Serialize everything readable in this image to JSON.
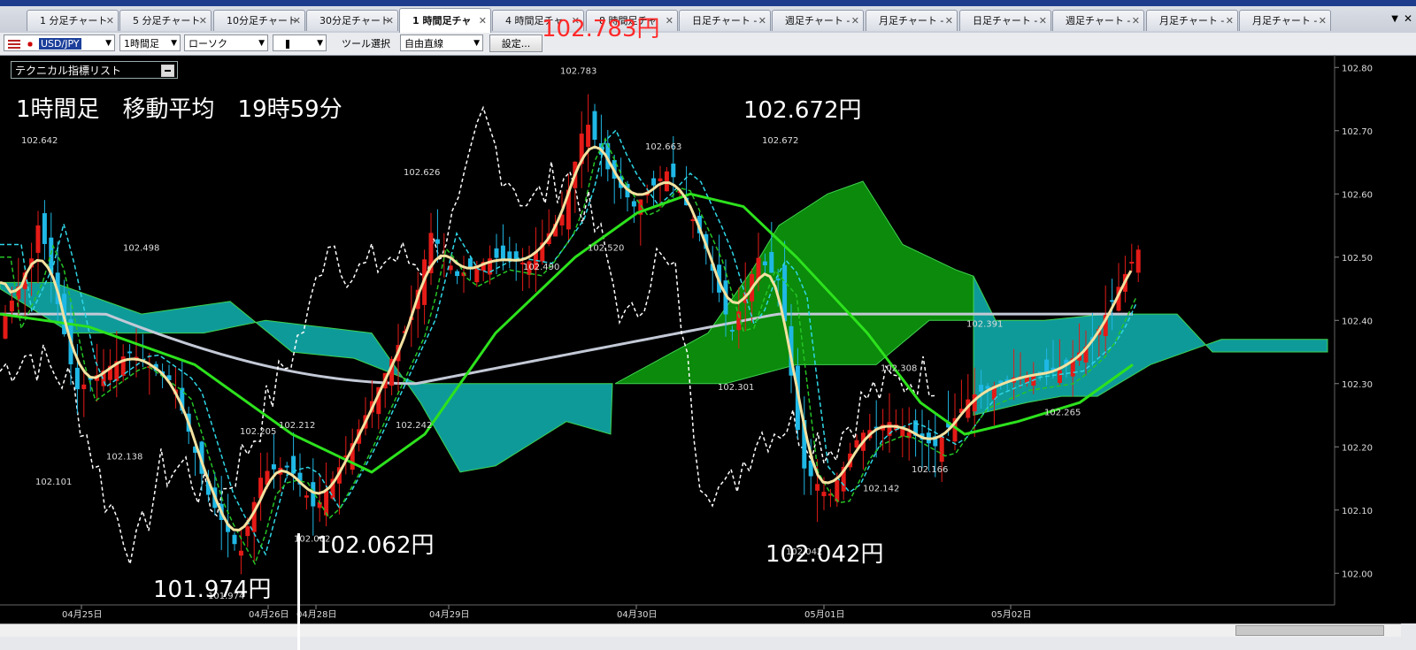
{
  "tabs": [
    {
      "label": "1 分足チャート",
      "active": false
    },
    {
      "label": "5 分足チャート",
      "active": false
    },
    {
      "label": "10分足チャート",
      "active": false
    },
    {
      "label": "30分足チャート",
      "active": false
    },
    {
      "label": "1 時間足チャ",
      "active": true
    },
    {
      "label": "4 時間足チャ",
      "active": false
    },
    {
      "label": "8 時間足チャ",
      "active": false
    },
    {
      "label": "日足チャート -",
      "active": false
    },
    {
      "label": "週足チャート -",
      "active": false
    },
    {
      "label": "月足チャート -",
      "active": false
    },
    {
      "label": "日足チャート -",
      "active": false
    },
    {
      "label": "週足チャート -",
      "active": false
    },
    {
      "label": "月足チャート -",
      "active": false
    },
    {
      "label": "月足チャート -",
      "active": false
    }
  ],
  "toolbar": {
    "symbol": "USD/JPY",
    "timeframe": "1時間足",
    "chart_type": "ローソク",
    "tool_label": "ツール選択",
    "tool_value": "自由直線",
    "settings_button": "設定..."
  },
  "indicator_list_label": "テクニカル指標リスト",
  "overlay_text": {
    "heading": "1時間足　移動平均　19時59分",
    "top_red": "102.783円",
    "high_right": "102.672円",
    "low_left": "101.974円",
    "low_mid": "102.062円",
    "low_right": "102.042円"
  },
  "colors": {
    "bull": "#e41b17",
    "bear": "#1fb8e6",
    "ma_short": "#f3e2a0",
    "ma_mid": "#2de21d",
    "ma_long": "#c3c9d6",
    "cloud_green": "#0b8a0b",
    "cloud_teal": "#0f9a9a"
  },
  "chart_data": {
    "type": "candlestick",
    "symbol": "USD/JPY",
    "timeframe": "1時間足",
    "ylim": [
      101.95,
      102.82
    ],
    "yticks": [
      "102.80",
      "102.70",
      "102.60",
      "102.50",
      "102.40",
      "102.30",
      "102.20",
      "102.10",
      "102.00"
    ],
    "xticks": [
      "04月25日",
      "04月26日",
      "04月28日",
      "04月29日",
      "04月30日",
      "05月01日",
      "05月02日"
    ],
    "price_labels": [
      "102.642",
      "102.498",
      "102.138",
      "102.101",
      "101.974",
      "102.205",
      "102.212",
      "102.062",
      "102.626",
      "102.242",
      "102.783",
      "102.490",
      "102.520",
      "102.663",
      "102.672",
      "102.301",
      "102.042",
      "102.308",
      "102.142",
      "102.166",
      "102.391",
      "102.265"
    ]
  }
}
